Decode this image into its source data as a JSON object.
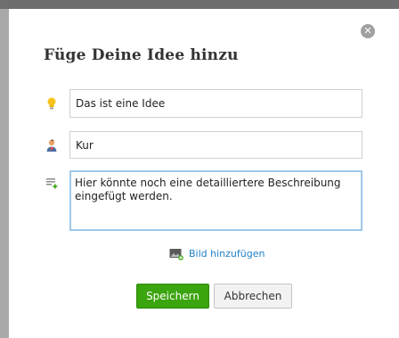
{
  "dialog": {
    "title": "Füge Deine Idee hinzu",
    "close_icon": "close-icon",
    "fields": {
      "title_value": "Das ist eine Idee",
      "title_icon": "lightbulb-icon",
      "author_value": "Kur",
      "author_icon": "user-icon",
      "description_value": "Hier könnte noch eine detailliertere Beschreibung eingefügt werden.",
      "description_icon": "list-add-icon"
    },
    "add_image": {
      "label": "Bild hinzufügen",
      "icon": "image-add-icon"
    },
    "buttons": {
      "save_label": "Speichern",
      "cancel_label": "Abbrechen"
    },
    "colors": {
      "save": "#3aa50e",
      "link": "#1f7fc5",
      "focus_border": "#9fc8ea"
    }
  }
}
